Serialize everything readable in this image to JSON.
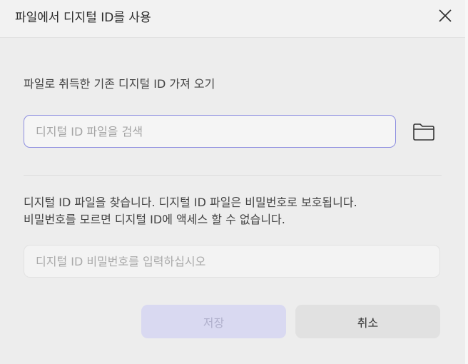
{
  "dialog": {
    "title": "파일에서 디지털 ID를 사용",
    "close_icon": "close-icon",
    "subtitle": "파일로 취득한 기존 디지털 ID 가져 오기",
    "search": {
      "placeholder": "디지털 ID 파일을 검색",
      "value": ""
    },
    "folder_icon": "folder-icon",
    "info_line1": "디지털 ID 파일을 찾습니다. 디지털 ID 파일은 비밀번호로 보호됩니다.",
    "info_line2": "비밀번호를 모르면 디지털 ID에 액세스 할 수 없습니다.",
    "password": {
      "placeholder": "디지털 ID 비밀번호를 입력하십시오",
      "value": ""
    },
    "buttons": {
      "save": "저장",
      "cancel": "취소"
    }
  },
  "colors": {
    "accent_border": "#8d8ee0",
    "save_disabled_bg": "#d9d9f1"
  }
}
